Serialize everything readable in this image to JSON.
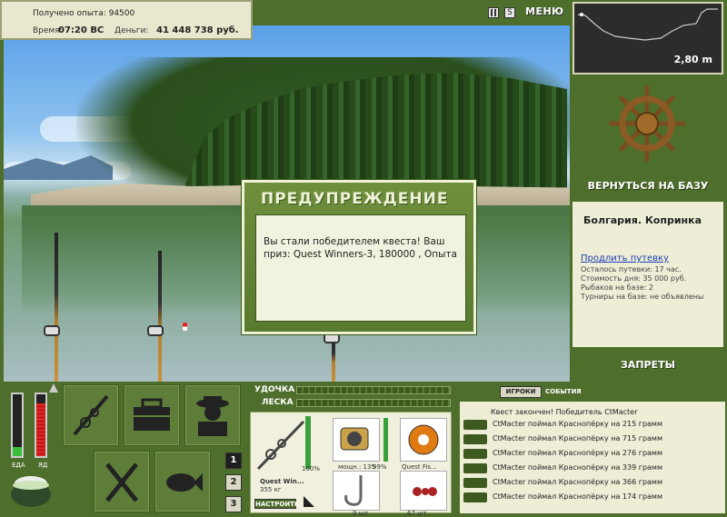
{
  "stats": {
    "exp_text": "Получено опыта: 94500",
    "time_label": "Время:",
    "time_value": "07:20 ВС",
    "money_label": "Деньги:",
    "money_value": "41 448 738 руб."
  },
  "toolbar": {
    "pause": "II",
    "sound": "S",
    "menu": "МЕНЮ"
  },
  "depth": {
    "value": "2,80 m"
  },
  "base": {
    "return_label": "ВЕРНУТЬСЯ НА БАЗУ"
  },
  "location": {
    "title": "Болгария. Копринка",
    "link": "Продлить путевку",
    "lines": [
      "Осталось путевки: 17 час.",
      "Стоимость дня: 35 000 руб.",
      "Рыбаков на базе: 2",
      "Турниры на базе: не объявлены"
    ]
  },
  "bans_label": "ЗАПРЕТЫ",
  "modal": {
    "title": "ПРЕДУПРЕЖДЕНИЕ",
    "text": "Вы стали победителем квеста! Ваш приз: Quest Winners-3, 180000 , Опыта"
  },
  "meters": {
    "food_label": "ЕДА",
    "poison_label": "ЯД",
    "food_level": 0.15,
    "poison_level": 0.85
  },
  "pages": [
    "1",
    "2",
    "3"
  ],
  "tackle": {
    "rod_label": "УДОЧКА",
    "line_label": "ЛЕСКА",
    "rod_name": "Quest Win...",
    "rod_weight": "355 кг",
    "rod_percent": "100%",
    "reel_power": "мощн.: 135",
    "reel_percent": "99%",
    "line_name": "Quest Fis...",
    "hook_count": "9 шт.",
    "bait_count": "67 шт.",
    "setup_label": "НАСТРОИТЬ"
  },
  "events": {
    "tab_players": "ИГРОКИ",
    "tab_events": "СОБЫТИЯ",
    "quest": "Квест закончен! Победитель CtMacter",
    "rows": [
      "CtMacter поймал Краснопёрку на 215 грамм",
      "CtMacter поймал Краснопёрку на 715 грамм",
      "CtMacter поймал Краснопёрку на 276 грамм",
      "CtMacter поймал Краснопёрку на 339 грамм",
      "CtMacter поймал Краснопёрку на 366 грамм",
      "CtMacter поймал Краснопёрку на 174 грамм"
    ]
  }
}
